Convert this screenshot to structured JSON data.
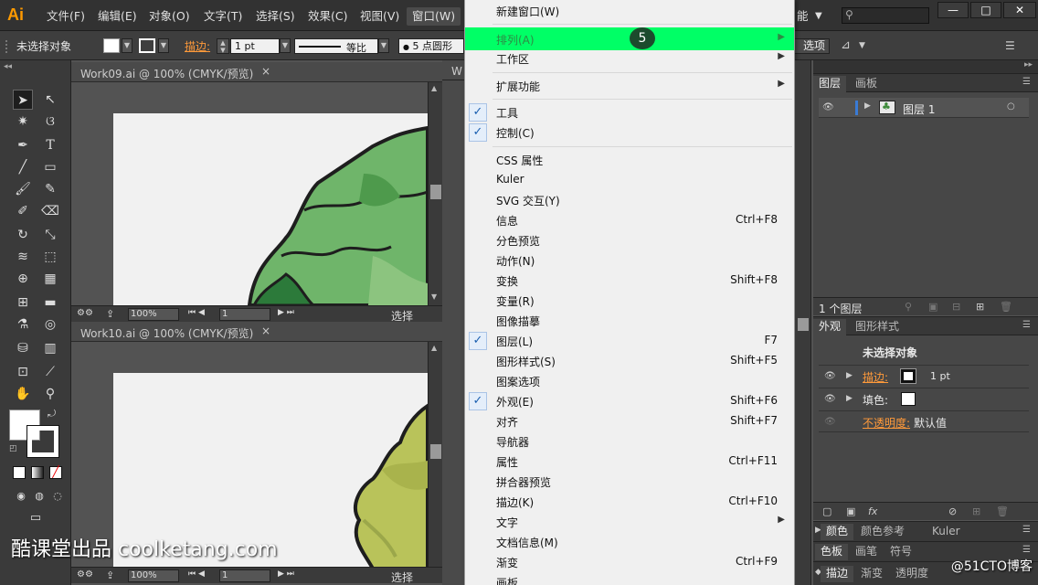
{
  "menubar": {
    "logo": "Ai",
    "items": [
      "文件(F)",
      "编辑(E)",
      "对象(O)",
      "文字(T)",
      "选择(S)",
      "效果(C)",
      "视图(V)",
      "窗口(W)"
    ],
    "right_partial": "能",
    "win_buttons": [
      "—",
      "□",
      "✕"
    ]
  },
  "controlbar": {
    "selection": "未选择对象",
    "stroke_label": "描边:",
    "stroke_value": "1 pt",
    "profile_label": "等比",
    "brush_label": "5 点圆形",
    "options_partial": "选项"
  },
  "doc1": {
    "tab_title": "Work09.ai @ 100% (CMYK/预览)",
    "close": "×",
    "zoom": "100%",
    "page": "1",
    "status": "选择"
  },
  "doc2": {
    "tab_title": "Work10.ai @ 100% (CMYK/预览)",
    "close": "×",
    "zoom": "100%",
    "page": "1",
    "status": "选择"
  },
  "window_menu": {
    "items": [
      {
        "label": "新建窗口(W)",
        "shortcut": "",
        "check": false,
        "sub": false
      },
      {
        "label": "排列(A)",
        "shortcut": "",
        "check": false,
        "sub": true,
        "highlight": true
      },
      {
        "label": "工作区",
        "shortcut": "",
        "check": false,
        "sub": true
      },
      {
        "label": "扩展功能",
        "shortcut": "",
        "check": false,
        "sub": true
      },
      {
        "label": "工具",
        "shortcut": "",
        "check": true,
        "sub": false
      },
      {
        "label": "控制(C)",
        "shortcut": "",
        "check": true,
        "sub": false
      },
      {
        "label": "CSS 属性",
        "shortcut": "",
        "check": false,
        "sub": false
      },
      {
        "label": "Kuler",
        "shortcut": "",
        "check": false,
        "sub": false
      },
      {
        "label": "SVG 交互(Y)",
        "shortcut": "",
        "check": false,
        "sub": false
      },
      {
        "label": "信息",
        "shortcut": "Ctrl+F8",
        "check": false,
        "sub": false
      },
      {
        "label": "分色预览",
        "shortcut": "",
        "check": false,
        "sub": false
      },
      {
        "label": "动作(N)",
        "shortcut": "",
        "check": false,
        "sub": false
      },
      {
        "label": "变换",
        "shortcut": "Shift+F8",
        "check": false,
        "sub": false
      },
      {
        "label": "变量(R)",
        "shortcut": "",
        "check": false,
        "sub": false
      },
      {
        "label": "图像描摹",
        "shortcut": "",
        "check": false,
        "sub": false
      },
      {
        "label": "图层(L)",
        "shortcut": "F7",
        "check": true,
        "sub": false
      },
      {
        "label": "图形样式(S)",
        "shortcut": "Shift+F5",
        "check": false,
        "sub": false
      },
      {
        "label": "图案选项",
        "shortcut": "",
        "check": false,
        "sub": false
      },
      {
        "label": "外观(E)",
        "shortcut": "Shift+F6",
        "check": true,
        "sub": false
      },
      {
        "label": "对齐",
        "shortcut": "Shift+F7",
        "check": false,
        "sub": false
      },
      {
        "label": "导航器",
        "shortcut": "",
        "check": false,
        "sub": false
      },
      {
        "label": "属性",
        "shortcut": "Ctrl+F11",
        "check": false,
        "sub": false
      },
      {
        "label": "拼合器预览",
        "shortcut": "",
        "check": false,
        "sub": false
      },
      {
        "label": "描边(K)",
        "shortcut": "Ctrl+F10",
        "check": false,
        "sub": false
      },
      {
        "label": "文字",
        "shortcut": "",
        "check": false,
        "sub": true
      },
      {
        "label": "文档信息(M)",
        "shortcut": "",
        "check": false,
        "sub": false
      },
      {
        "label": "渐变",
        "shortcut": "Ctrl+F9",
        "check": false,
        "sub": false
      },
      {
        "label": "画板",
        "shortcut": "",
        "check": false,
        "sub": false
      }
    ],
    "step_badge": "5"
  },
  "layers_panel": {
    "tabs": [
      "图层",
      "画板"
    ],
    "layer_name": "图层 1",
    "footer": "1 个图层"
  },
  "appearance_panel": {
    "tabs": [
      "外观",
      "图形样式"
    ],
    "title": "未选择对象",
    "stroke_label": "描边:",
    "stroke_value": "1 pt",
    "fill_label": "填色:",
    "opacity_label": "不透明度:",
    "opacity_value": "默认值"
  },
  "bottom_panels": {
    "row1": [
      "颜色",
      "颜色参考",
      "Kuler"
    ],
    "row2": [
      "色板",
      "画笔",
      "符号"
    ],
    "row3": [
      "描边",
      "渐变",
      "透明度"
    ]
  },
  "watermark": {
    "left": "酷课堂出品 coolketang.com",
    "right": "@51CTO博客"
  },
  "colors": {
    "highlight": "#00ff66",
    "accent_orange": "#ff9a3a",
    "leaf_green": "#6fb56a",
    "leaf_yellow": "#b9c35a"
  }
}
